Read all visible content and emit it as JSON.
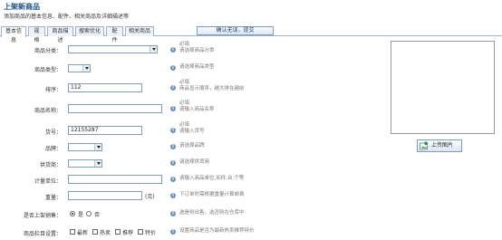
{
  "header": {
    "title": "上架新商品",
    "subtitle": "添加商品的基本信息、配件、相关商品及详细描述等"
  },
  "tabs": [
    {
      "label": "基本信息",
      "active": true
    },
    {
      "label": "规格",
      "active": false
    },
    {
      "label": "商品描述",
      "active": false
    },
    {
      "label": "搜索优化",
      "active": false
    },
    {
      "label": "配件",
      "active": false
    },
    {
      "label": "相关商品",
      "active": false
    }
  ],
  "submit_label": "确认无误，提交",
  "fields": {
    "category": {
      "label": "商品分类：",
      "hint1": "必填",
      "hint2": "请选择商品分类",
      "value": ""
    },
    "type": {
      "label": "商品类型：",
      "hint1": "请选择商品类型",
      "value": ""
    },
    "sort": {
      "label": "排序：",
      "value": "112",
      "hint1": "必填",
      "hint2": "商品显示顺序，越大排在越前"
    },
    "name": {
      "label": "商品名称：",
      "value": "",
      "hint1": "必填",
      "hint2": "请输入商品名称"
    },
    "sku": {
      "label": "货号：",
      "value": "12155287",
      "hint1": "必填",
      "hint2": "请输入货号"
    },
    "brand": {
      "label": "品牌：",
      "value": "",
      "hint1": "请选择品牌"
    },
    "supplier": {
      "label": "供货商：",
      "value": "",
      "hint1": "请选择供货商"
    },
    "unit": {
      "label": "计量单位：",
      "value": "",
      "hint1": "请输入商品单位,如件,台,个等"
    },
    "weight": {
      "label": "重量：",
      "value": "",
      "unit": "(克)",
      "hint1": "下订单时需根据重量计算邮费"
    },
    "on_sale": {
      "label": "是否上架销售：",
      "yes": "是",
      "no": "否",
      "hint1": "选是则出售，选否则在仓库中"
    },
    "flags": {
      "label": "商品栏目设置：",
      "options": [
        "最新",
        "热卖",
        "推荐",
        "特价"
      ],
      "hint1": "设置商品是否为最新热卖推荐特价"
    }
  },
  "upload_label": "上传图片",
  "colors": {
    "title": "#1a4f8b",
    "info_icon": "#6b8fb8",
    "border": "#7f9db9"
  }
}
